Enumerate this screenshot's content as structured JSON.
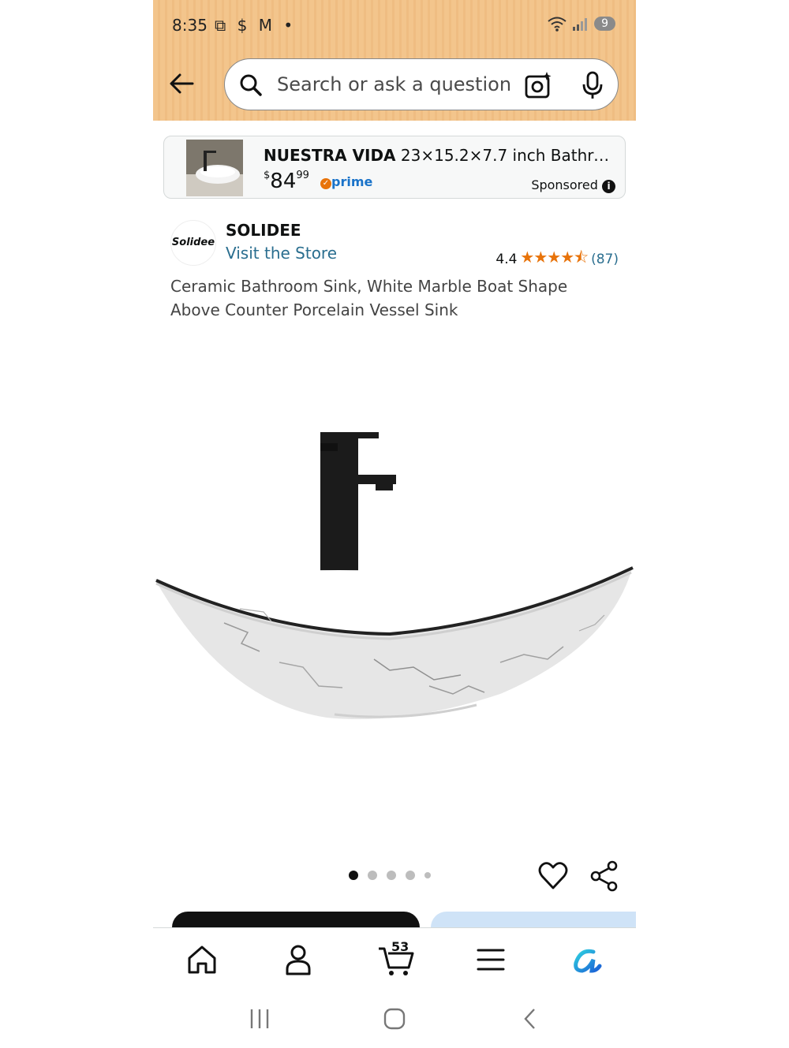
{
  "status_bar": {
    "time": "8:35",
    "left_icons": [
      "screenshot-icon",
      "dollar-icon",
      "gmail-icon",
      "dot-icon"
    ],
    "right_icons": [
      "wifi-icon",
      "signal-icon"
    ],
    "battery": "9"
  },
  "search": {
    "placeholder": "Search or ask a question"
  },
  "sponsored_ad": {
    "brand": "NUESTRA VIDA",
    "title_rest": " 23×15.2×7.7 inch Bathro…",
    "price_symbol": "$",
    "price_whole": "84",
    "price_fraction": "99",
    "prime_label": "prime",
    "sponsored_label": "Sponsored"
  },
  "brand": {
    "logo_text": "Solidee",
    "name": "SOLIDEE",
    "visit_store": "Visit the Store",
    "rating": "4.4",
    "stars": "★★★★⯪",
    "review_count": "(87)"
  },
  "product": {
    "title": "Ceramic Bathroom Sink, White Marble Boat Shape Above Counter Porcelain Vessel Sink",
    "image_count_dots": 5,
    "active_image": 0
  },
  "bottom_nav": {
    "items": [
      "home-icon",
      "account-icon",
      "cart-icon",
      "menu-icon",
      "rufus-icon"
    ],
    "cart_count": "53"
  },
  "colors": {
    "header_bg": "#f3c58c",
    "link": "#2a6e8f",
    "star": "#e8730a",
    "prime": "#1a73c9"
  }
}
